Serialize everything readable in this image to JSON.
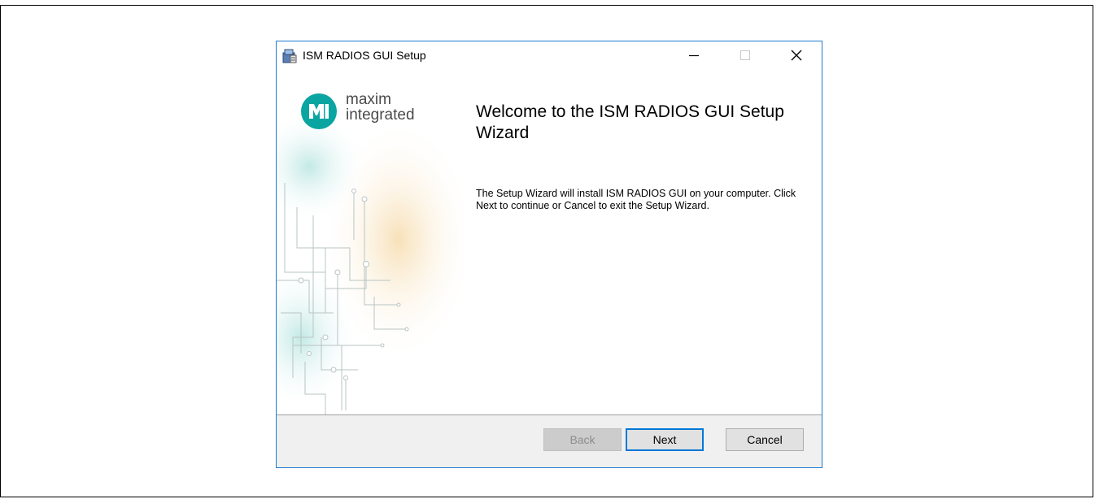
{
  "window": {
    "title": "ISM RADIOS GUI Setup",
    "icons": {
      "app": "setup-installer-icon",
      "minimize": "minimize-icon",
      "maximize": "maximize-icon",
      "close": "close-icon"
    }
  },
  "brand": {
    "logo_icon": "maxim-logo-icon",
    "logo_line1": "maxim",
    "logo_line2": "integrated",
    "accent_color": "#0aa5a0"
  },
  "content": {
    "title": "Welcome to the ISM RADIOS GUI Setup Wizard",
    "body": "The Setup Wizard will install ISM RADIOS GUI on your computer. Click Next to continue or Cancel to exit the Setup Wizard."
  },
  "buttons": {
    "back": "Back",
    "next": "Next",
    "cancel": "Cancel"
  },
  "colors": {
    "focus_border": "#0078d7",
    "window_border": "#1e7bd0",
    "footer_bg": "#f0f0f0"
  }
}
